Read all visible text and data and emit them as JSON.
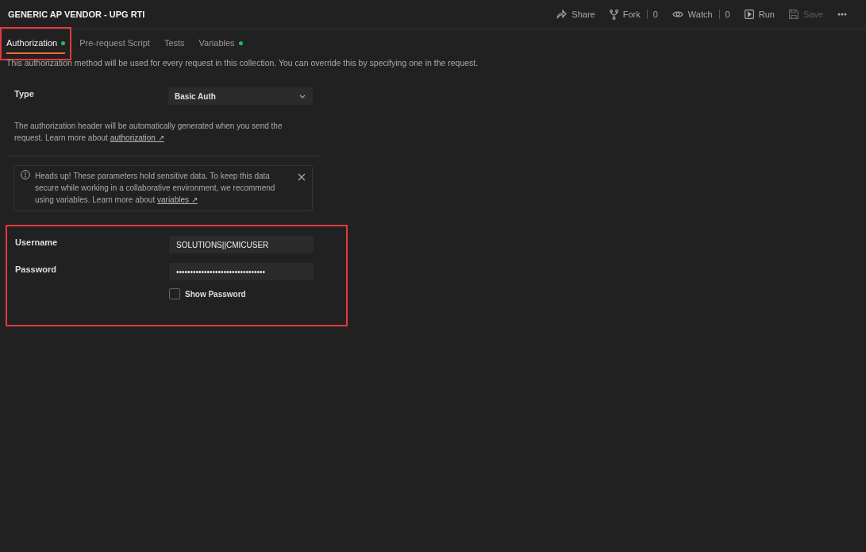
{
  "header": {
    "title": "GENERIC AP VENDOR - UPG RTI",
    "actions": [
      {
        "kind": "share",
        "label": "Share",
        "disabled": false
      },
      {
        "kind": "fork",
        "label": "Fork",
        "count": "0",
        "disabled": false
      },
      {
        "kind": "watch",
        "label": "Watch",
        "count": "0",
        "disabled": false
      },
      {
        "kind": "run",
        "label": "Run",
        "disabled": false
      },
      {
        "kind": "save",
        "label": "Save",
        "disabled": true
      },
      {
        "kind": "more",
        "disabled": false
      }
    ]
  },
  "tabs": [
    {
      "label": "Authorization",
      "selected": true,
      "indicator": true,
      "highlighted": true
    },
    {
      "label": "Pre-request Script",
      "selected": false,
      "indicator": false
    },
    {
      "label": "Tests",
      "selected": false,
      "indicator": false
    },
    {
      "label": "Variables",
      "selected": false,
      "indicator": true
    }
  ],
  "description": "This authorization method will be used for every request in this collection. You can override this by specifying one in the request.",
  "type": {
    "label": "Type",
    "value": "Basic Auth"
  },
  "help": {
    "text": "The authorization header will be automatically generated when you send the request. Learn more about ",
    "link": "authorization",
    "arrow": "↗"
  },
  "alert": {
    "text": "Heads up! These parameters hold sensitive data. To keep this data secure while working in a collaborative environment, we recommend using variables. Learn more about ",
    "link": "variables",
    "arrow": "↗"
  },
  "username": {
    "label": "Username",
    "value": "SOLUTIONS||CMICUSER"
  },
  "password": {
    "label": "Password",
    "value": "••••••••••••••••••••••••••••••••"
  },
  "show_password": {
    "label": "Show Password",
    "checked": false
  },
  "credentials_highlighted": true
}
